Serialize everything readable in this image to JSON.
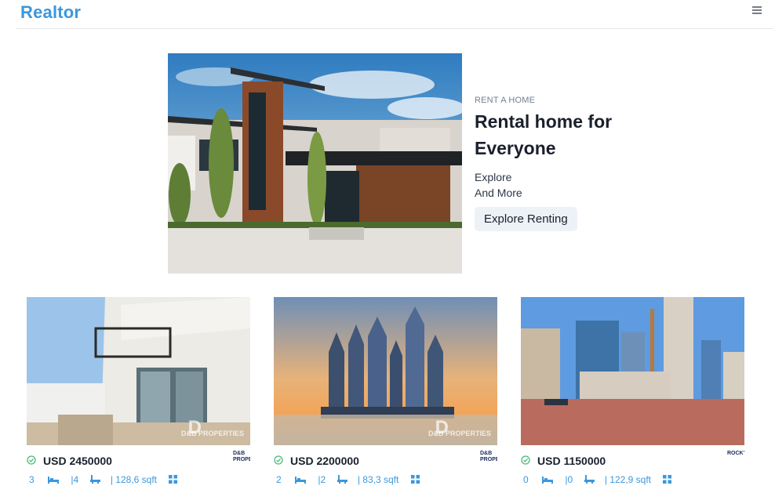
{
  "nav": {
    "logo": "Realtor",
    "menu_icon": "hamburger-menu-icon"
  },
  "hero": {
    "eyebrow": "RENT A HOME",
    "title_line1": "Rental home for",
    "title_line2": "Everyone",
    "desc_line1": "Explore",
    "desc_line2": "And More",
    "button": "Explore Renting"
  },
  "colors": {
    "brand": "#3b97dd",
    "text": "#1a202c",
    "verified": "#48bb78"
  },
  "listings": [
    {
      "price": "USD 2450000",
      "rooms": "3",
      "baths": "|4",
      "area": "| 128,6 sqft",
      "agency": "D&B PROPERTIES",
      "watermark": "D&B PROPERTIES"
    },
    {
      "price": "USD 2200000",
      "rooms": "2",
      "baths": "|2",
      "area": "| 83,3 sqft",
      "agency": "D&B PROPERTIES",
      "watermark": "D&B PROPERTIES"
    },
    {
      "price": "USD 1150000",
      "rooms": "0",
      "baths": "|0",
      "area": "| 122,9 sqft",
      "agency": "ROCKY",
      "watermark": ""
    }
  ]
}
